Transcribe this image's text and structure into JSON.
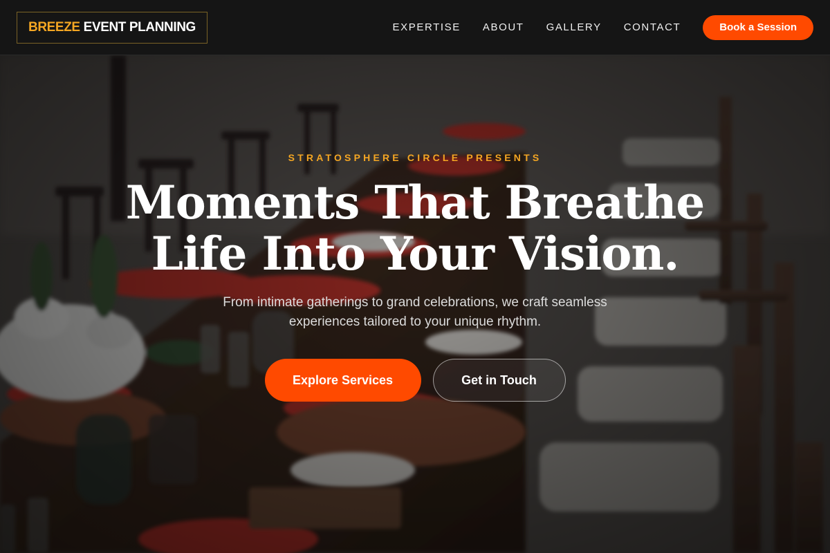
{
  "brand": {
    "accent_text": "BREEZE",
    "rest_text": "EVENT PLANNING",
    "accent_color": "#f4a623"
  },
  "nav": {
    "items": [
      {
        "label": "EXPERTISE"
      },
      {
        "label": "ABOUT"
      },
      {
        "label": "GALLERY"
      },
      {
        "label": "CONTACT"
      }
    ],
    "cta_label": "Book a Session"
  },
  "hero": {
    "eyebrow": "STRATOSPHERE CIRCLE PRESENTS",
    "headline_line1": "Moments That Breathe",
    "headline_line2": "Life Into Your Vision.",
    "subhead": "From intimate gatherings to grand celebrations, we craft seamless experiences tailored to your unique rhythm.",
    "primary_button": "Explore Services",
    "secondary_button": "Get in Touch",
    "background_image": "outdoor-dining-table-with-red-napkins"
  },
  "colors": {
    "primary": "#ff4a00",
    "accent": "#f4a623",
    "header_bg": "#151515",
    "text_light": "#ffffff"
  }
}
